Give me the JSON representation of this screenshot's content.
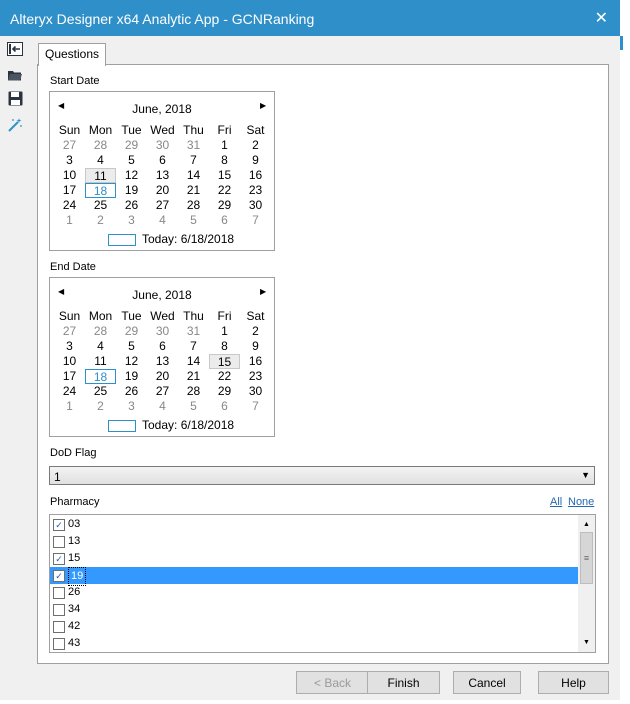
{
  "window": {
    "title": "Alteryx Designer x64 Analytic App - GCNRanking",
    "close_glyph": "✕",
    "accent_color": "#2e8fc9"
  },
  "sidebar": {
    "icons": [
      "collapse-icon",
      "open-folder-icon",
      "save-icon",
      "magic-wand-icon"
    ]
  },
  "tabs": [
    {
      "label": "Questions"
    }
  ],
  "start_date": {
    "label": "Start Date",
    "month_label": "June, 2018",
    "prev_glyph": "◀",
    "next_glyph": "▶",
    "weekdays": [
      "Sun",
      "Mon",
      "Tue",
      "Wed",
      "Thu",
      "Fri",
      "Sat"
    ],
    "days": [
      "27",
      "28",
      "29",
      "30",
      "31",
      "1",
      "2",
      "3",
      "4",
      "5",
      "6",
      "7",
      "8",
      "9",
      "10",
      "11",
      "12",
      "13",
      "14",
      "15",
      "16",
      "17",
      "18",
      "19",
      "20",
      "21",
      "22",
      "23",
      "24",
      "25",
      "26",
      "27",
      "28",
      "29",
      "30",
      "1",
      "2",
      "3",
      "4",
      "5",
      "6",
      "7"
    ],
    "today_text": "Today: 6/18/2018"
  },
  "end_date": {
    "label": "End Date",
    "month_label": "June, 2018",
    "prev_glyph": "◀",
    "next_glyph": "▶",
    "weekdays": [
      "Sun",
      "Mon",
      "Tue",
      "Wed",
      "Thu",
      "Fri",
      "Sat"
    ],
    "days": [
      "27",
      "28",
      "29",
      "30",
      "31",
      "1",
      "2",
      "3",
      "4",
      "5",
      "6",
      "7",
      "8",
      "9",
      "10",
      "11",
      "12",
      "13",
      "14",
      "15",
      "16",
      "17",
      "18",
      "19",
      "20",
      "21",
      "22",
      "23",
      "24",
      "25",
      "26",
      "27",
      "28",
      "29",
      "30",
      "1",
      "2",
      "3",
      "4",
      "5",
      "6",
      "7"
    ],
    "today_text": "Today: 6/18/2018"
  },
  "dod_flag": {
    "label": "DoD Flag",
    "value": "1",
    "arrow_glyph": "▼"
  },
  "pharmacy": {
    "label": "Pharmacy",
    "all_link": "All",
    "none_link": "None",
    "check_glyph": "✓",
    "items": [
      {
        "label": "03",
        "checked": true
      },
      {
        "label": "13",
        "checked": false
      },
      {
        "label": "15",
        "checked": true
      },
      {
        "label": "19",
        "checked": true
      },
      {
        "label": "26",
        "checked": false
      },
      {
        "label": "34",
        "checked": false
      },
      {
        "label": "42",
        "checked": false
      },
      {
        "label": "43",
        "checked": false
      }
    ]
  },
  "buttons": {
    "back": "< Back",
    "finish": "Finish",
    "cancel": "Cancel",
    "help": "Help"
  }
}
